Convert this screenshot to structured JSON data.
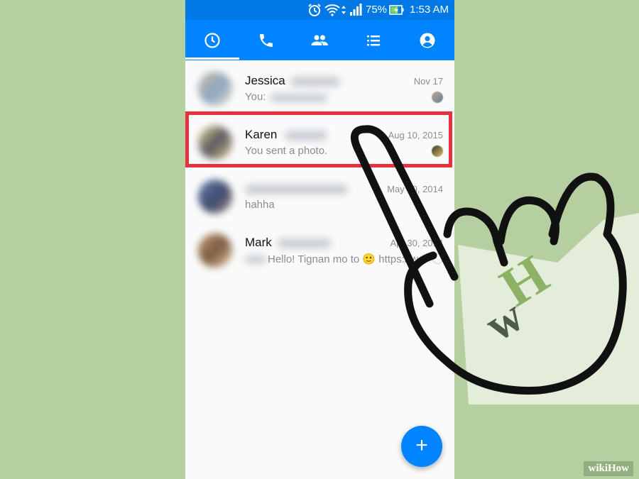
{
  "status_bar": {
    "battery_percent": "75%",
    "time": "1:53 AM",
    "icons": [
      "alarm-icon",
      "wifi-icon",
      "data-arrows-icon",
      "signal-icon",
      "battery-charging-icon"
    ]
  },
  "tabs": [
    {
      "name": "recent",
      "icon": "clock-icon",
      "active": true
    },
    {
      "name": "calls",
      "icon": "phone-icon",
      "active": false
    },
    {
      "name": "groups",
      "icon": "people-icon",
      "active": false
    },
    {
      "name": "people",
      "icon": "list-icon",
      "active": false
    },
    {
      "name": "profile",
      "icon": "account-icon",
      "active": false
    }
  ],
  "conversations": [
    {
      "name": "Jessica",
      "date": "Nov 17",
      "preview": "You:"
    },
    {
      "name": "Karen",
      "date": "Aug 10, 2015",
      "preview": "You sent a photo."
    },
    {
      "name": "",
      "date": "May 30, 2014",
      "preview": "hahha"
    },
    {
      "name": "Mark",
      "date": "Apr 30, 2014",
      "preview": "Hello! Tignan mo to 🙂 https://w..."
    }
  ],
  "fab": {
    "label": "+"
  },
  "watermark": {
    "logo_text": "wH",
    "brand": "wikiHow"
  },
  "colors": {
    "messenger_blue": "#0084ff",
    "status_bar_blue": "#0078e6",
    "highlight_red": "#e8313e",
    "background_green": "#b5cfa1"
  }
}
